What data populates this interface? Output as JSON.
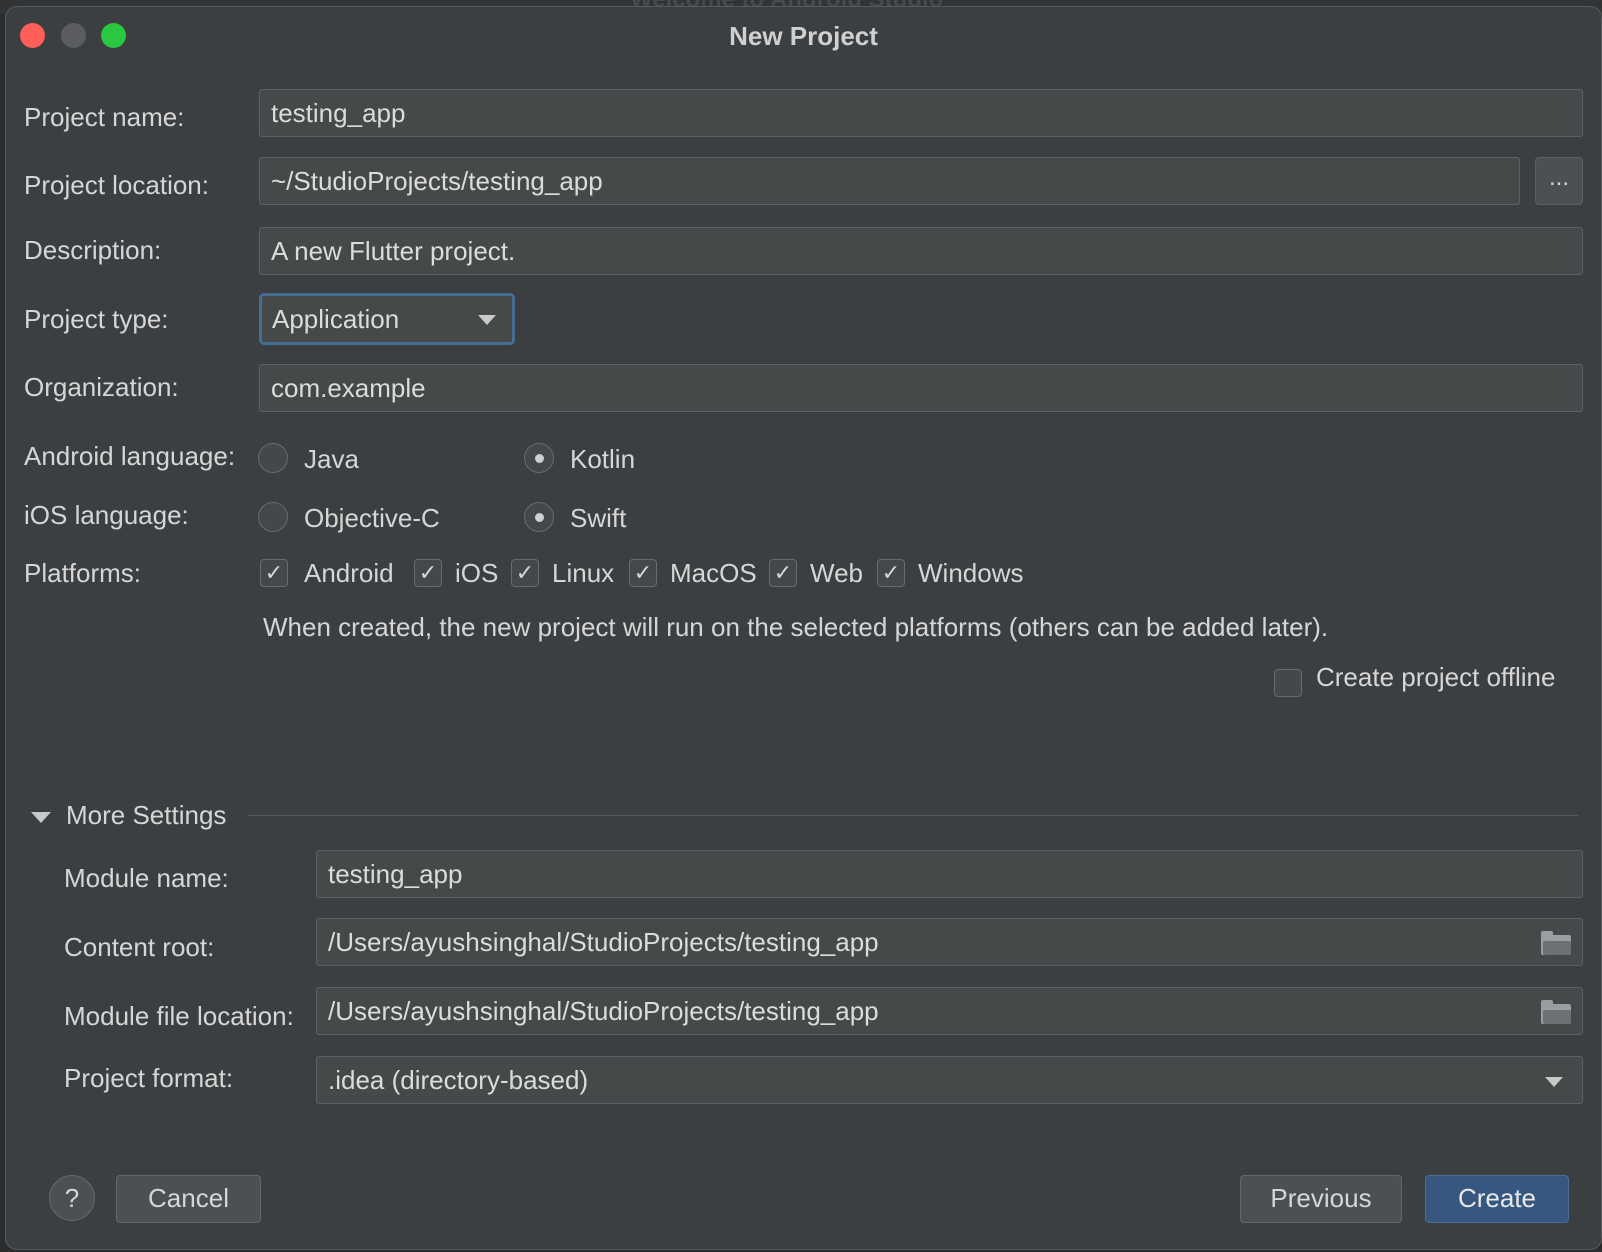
{
  "window": {
    "title": "New Project",
    "background_title": "Welcome to Android Studio"
  },
  "form": {
    "project_name": {
      "label": "Project name:",
      "value": "testing_app"
    },
    "project_location": {
      "label": "Project location:",
      "value": "~/StudioProjects/testing_app",
      "browse_label": "..."
    },
    "description": {
      "label": "Description:",
      "value": "A new Flutter project."
    },
    "project_type": {
      "label": "Project type:",
      "value": "Application"
    },
    "organization": {
      "label": "Organization:",
      "value": "com.example"
    },
    "android_language": {
      "label": "Android language:",
      "options": [
        {
          "label": "Java",
          "selected": false
        },
        {
          "label": "Kotlin",
          "selected": true
        }
      ]
    },
    "ios_language": {
      "label": "iOS language:",
      "options": [
        {
          "label": "Objective-C",
          "selected": false
        },
        {
          "label": "Swift",
          "selected": true
        }
      ]
    },
    "platforms": {
      "label": "Platforms:",
      "items": [
        {
          "label": "Android",
          "checked": true
        },
        {
          "label": "iOS",
          "checked": true
        },
        {
          "label": "Linux",
          "checked": true
        },
        {
          "label": "MacOS",
          "checked": true
        },
        {
          "label": "Web",
          "checked": true
        },
        {
          "label": "Windows",
          "checked": true
        }
      ],
      "hint": "When created, the new project will run on the selected platforms (others can be added later)."
    },
    "offline": {
      "label": "Create project offline",
      "checked": false
    }
  },
  "more_settings": {
    "title": "More Settings",
    "expanded": true,
    "module_name": {
      "label": "Module name:",
      "value": "testing_app"
    },
    "content_root": {
      "label": "Content root:",
      "value": "/Users/ayushsinghal/StudioProjects/testing_app"
    },
    "module_file_location": {
      "label": "Module file location:",
      "value": "/Users/ayushsinghal/StudioProjects/testing_app"
    },
    "project_format": {
      "label": "Project format:",
      "value": ".idea (directory-based)"
    }
  },
  "buttons": {
    "help": "?",
    "cancel": "Cancel",
    "previous": "Previous",
    "create": "Create"
  },
  "icons": {
    "checkmark": "✓",
    "folder": "folder-icon"
  },
  "colors": {
    "dialog_bg": "#3c3f41",
    "field_bg": "#45494a",
    "primary_button": "#365880",
    "focus_border": "#466d94",
    "close": "#fe5f57",
    "maximize": "#29c840"
  }
}
